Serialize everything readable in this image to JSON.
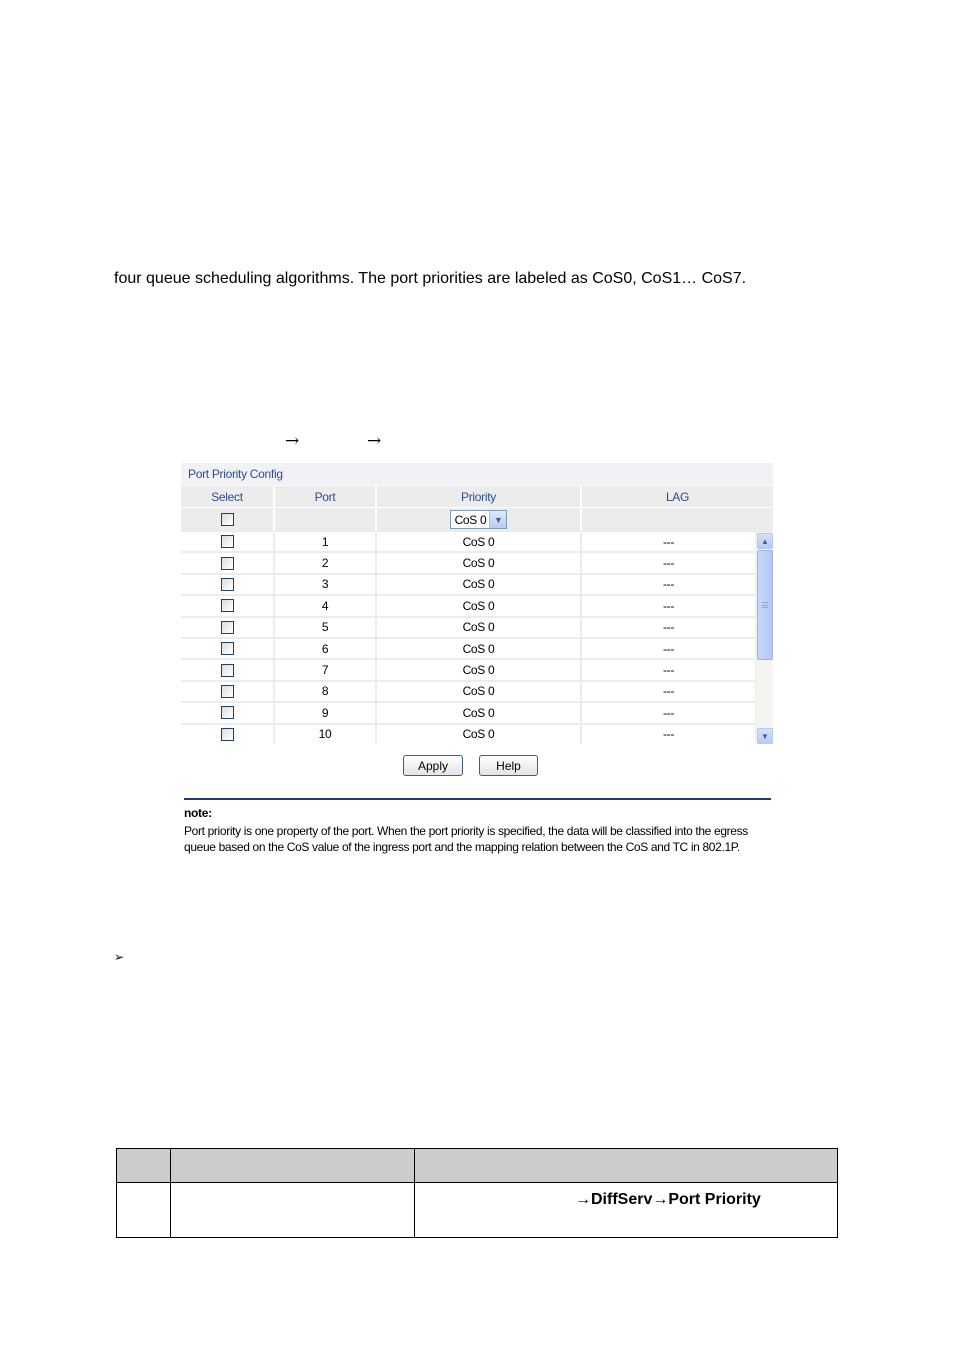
{
  "document": {
    "paragraph_line": "four queue scheduling algorithms. The port priorities are labeled as CoS0, CoS1… CoS7.",
    "nav_arrows": [
      "→",
      "→"
    ],
    "bullet_glyph": "➢"
  },
  "panel": {
    "title": "Port Priority Config",
    "columns": [
      "Select",
      "Port",
      "Priority",
      "LAG"
    ],
    "bulk_select": {
      "priority_value": "CoS 0",
      "dropdown_icon": "chevron-down-icon"
    },
    "rows": [
      {
        "port": "1",
        "priority": "CoS 0",
        "lag": "---"
      },
      {
        "port": "2",
        "priority": "CoS 0",
        "lag": "---"
      },
      {
        "port": "3",
        "priority": "CoS 0",
        "lag": "---"
      },
      {
        "port": "4",
        "priority": "CoS 0",
        "lag": "---"
      },
      {
        "port": "5",
        "priority": "CoS 0",
        "lag": "---"
      },
      {
        "port": "6",
        "priority": "CoS 0",
        "lag": "---"
      },
      {
        "port": "7",
        "priority": "CoS 0",
        "lag": "---"
      },
      {
        "port": "8",
        "priority": "CoS 0",
        "lag": "---"
      },
      {
        "port": "9",
        "priority": "CoS 0",
        "lag": "---"
      },
      {
        "port": "10",
        "priority": "CoS 0",
        "lag": "---"
      }
    ],
    "scroll": {
      "up_icon": "▲",
      "down_icon": "▼"
    },
    "buttons": {
      "apply": "Apply",
      "help": "Help"
    },
    "note": {
      "title": "note:",
      "text": "Port priority is one property of the port. When the port priority is specified, the data will be classified into the egress queue based on the CoS value of the ingress port and the mapping relation between the CoS and TC in 802.1P."
    }
  },
  "doc_table": {
    "row1_col3": "→DiffServ→Port  Priority"
  }
}
